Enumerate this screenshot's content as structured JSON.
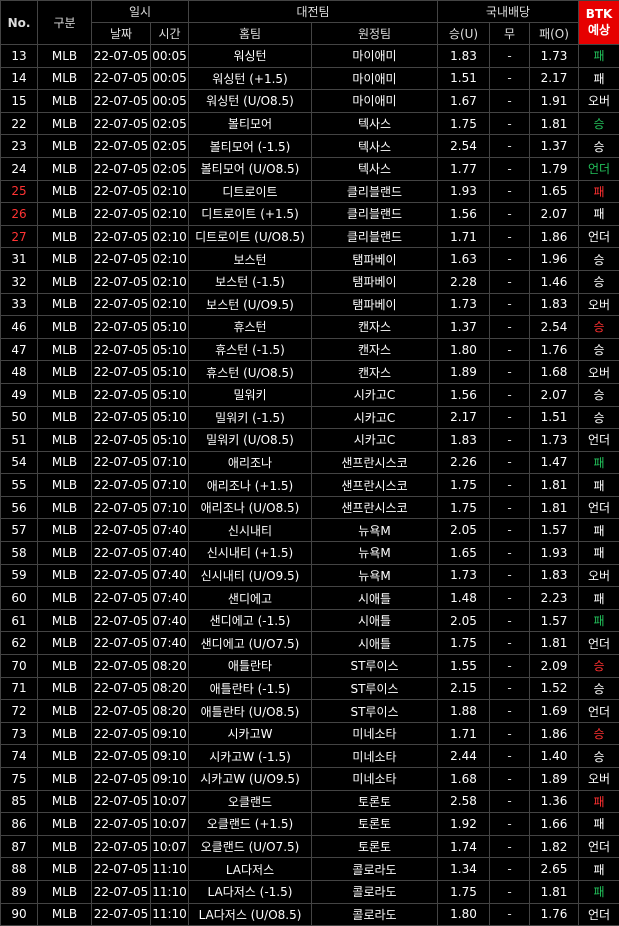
{
  "header": {
    "no": "No.",
    "category": "구분",
    "datetime": "일시",
    "date": "날짜",
    "time": "시간",
    "match": "대전팀",
    "home": "홈팀",
    "away": "원정팀",
    "odds": "국내배당",
    "win": "승(U)",
    "draw": "무",
    "lose": "패(O)",
    "btk_line1": "BTK",
    "btk_line2": "예상"
  },
  "colors": {
    "btk_header": "#e60000",
    "red": "#ff3030",
    "green": "#22c05a"
  },
  "rows": [
    {
      "no": "13",
      "no_color": "white",
      "cat": "MLB",
      "date": "22-07-05",
      "time": "00:05",
      "home": "워싱턴",
      "away": "마이애미",
      "win": "1.83",
      "draw": "-",
      "lose": "1.73",
      "pred": "패",
      "pred_color": "green"
    },
    {
      "no": "14",
      "no_color": "white",
      "cat": "MLB",
      "date": "22-07-05",
      "time": "00:05",
      "home": "워싱턴 (+1.5)",
      "away": "마이애미",
      "win": "1.51",
      "draw": "-",
      "lose": "2.17",
      "pred": "패",
      "pred_color": "white"
    },
    {
      "no": "15",
      "no_color": "white",
      "cat": "MLB",
      "date": "22-07-05",
      "time": "00:05",
      "home": "워싱턴 (U/O8.5)",
      "away": "마이애미",
      "win": "1.67",
      "draw": "-",
      "lose": "1.91",
      "pred": "오버",
      "pred_color": "white"
    },
    {
      "no": "22",
      "no_color": "white",
      "cat": "MLB",
      "date": "22-07-05",
      "time": "02:05",
      "home": "볼티모어",
      "away": "텍사스",
      "win": "1.75",
      "draw": "-",
      "lose": "1.81",
      "pred": "승",
      "pred_color": "green"
    },
    {
      "no": "23",
      "no_color": "white",
      "cat": "MLB",
      "date": "22-07-05",
      "time": "02:05",
      "home": "볼티모어 (-1.5)",
      "away": "텍사스",
      "win": "2.54",
      "draw": "-",
      "lose": "1.37",
      "pred": "승",
      "pred_color": "white"
    },
    {
      "no": "24",
      "no_color": "white",
      "cat": "MLB",
      "date": "22-07-05",
      "time": "02:05",
      "home": "볼티모어 (U/O8.5)",
      "away": "텍사스",
      "win": "1.77",
      "draw": "-",
      "lose": "1.79",
      "pred": "언더",
      "pred_color": "green"
    },
    {
      "no": "25",
      "no_color": "red",
      "cat": "MLB",
      "date": "22-07-05",
      "time": "02:10",
      "home": "디트로이트",
      "away": "클리블랜드",
      "win": "1.93",
      "draw": "-",
      "lose": "1.65",
      "pred": "패",
      "pred_color": "red"
    },
    {
      "no": "26",
      "no_color": "red",
      "cat": "MLB",
      "date": "22-07-05",
      "time": "02:10",
      "home": "디트로이트 (+1.5)",
      "away": "클리블랜드",
      "win": "1.56",
      "draw": "-",
      "lose": "2.07",
      "pred": "패",
      "pred_color": "white"
    },
    {
      "no": "27",
      "no_color": "red",
      "cat": "MLB",
      "date": "22-07-05",
      "time": "02:10",
      "home": "디트로이트 (U/O8.5)",
      "away": "클리블랜드",
      "win": "1.71",
      "draw": "-",
      "lose": "1.86",
      "pred": "언더",
      "pred_color": "white"
    },
    {
      "no": "31",
      "no_color": "white",
      "cat": "MLB",
      "date": "22-07-05",
      "time": "02:10",
      "home": "보스턴",
      "away": "탬파베이",
      "win": "1.63",
      "draw": "-",
      "lose": "1.96",
      "pred": "승",
      "pred_color": "white"
    },
    {
      "no": "32",
      "no_color": "white",
      "cat": "MLB",
      "date": "22-07-05",
      "time": "02:10",
      "home": "보스턴 (-1.5)",
      "away": "탬파베이",
      "win": "2.28",
      "draw": "-",
      "lose": "1.46",
      "pred": "승",
      "pred_color": "white"
    },
    {
      "no": "33",
      "no_color": "white",
      "cat": "MLB",
      "date": "22-07-05",
      "time": "02:10",
      "home": "보스턴 (U/O9.5)",
      "away": "탬파베이",
      "win": "1.73",
      "draw": "-",
      "lose": "1.83",
      "pred": "오버",
      "pred_color": "white"
    },
    {
      "no": "46",
      "no_color": "white",
      "cat": "MLB",
      "date": "22-07-05",
      "time": "05:10",
      "home": "휴스턴",
      "away": "캔자스",
      "win": "1.37",
      "draw": "-",
      "lose": "2.54",
      "pred": "승",
      "pred_color": "red"
    },
    {
      "no": "47",
      "no_color": "white",
      "cat": "MLB",
      "date": "22-07-05",
      "time": "05:10",
      "home": "휴스턴 (-1.5)",
      "away": "캔자스",
      "win": "1.80",
      "draw": "-",
      "lose": "1.76",
      "pred": "승",
      "pred_color": "white"
    },
    {
      "no": "48",
      "no_color": "white",
      "cat": "MLB",
      "date": "22-07-05",
      "time": "05:10",
      "home": "휴스턴 (U/O8.5)",
      "away": "캔자스",
      "win": "1.89",
      "draw": "-",
      "lose": "1.68",
      "pred": "오버",
      "pred_color": "white"
    },
    {
      "no": "49",
      "no_color": "white",
      "cat": "MLB",
      "date": "22-07-05",
      "time": "05:10",
      "home": "밀워키",
      "away": "시카고C",
      "win": "1.56",
      "draw": "-",
      "lose": "2.07",
      "pred": "승",
      "pred_color": "white"
    },
    {
      "no": "50",
      "no_color": "white",
      "cat": "MLB",
      "date": "22-07-05",
      "time": "05:10",
      "home": "밀워키 (-1.5)",
      "away": "시카고C",
      "win": "2.17",
      "draw": "-",
      "lose": "1.51",
      "pred": "승",
      "pred_color": "white"
    },
    {
      "no": "51",
      "no_color": "white",
      "cat": "MLB",
      "date": "22-07-05",
      "time": "05:10",
      "home": "밀워키 (U/O8.5)",
      "away": "시카고C",
      "win": "1.83",
      "draw": "-",
      "lose": "1.73",
      "pred": "언더",
      "pred_color": "white"
    },
    {
      "no": "54",
      "no_color": "white",
      "cat": "MLB",
      "date": "22-07-05",
      "time": "07:10",
      "home": "애리조나",
      "away": "샌프란시스코",
      "win": "2.26",
      "draw": "-",
      "lose": "1.47",
      "pred": "패",
      "pred_color": "green"
    },
    {
      "no": "55",
      "no_color": "white",
      "cat": "MLB",
      "date": "22-07-05",
      "time": "07:10",
      "home": "애리조나 (+1.5)",
      "away": "샌프란시스코",
      "win": "1.75",
      "draw": "-",
      "lose": "1.81",
      "pred": "패",
      "pred_color": "white"
    },
    {
      "no": "56",
      "no_color": "white",
      "cat": "MLB",
      "date": "22-07-05",
      "time": "07:10",
      "home": "애리조나 (U/O8.5)",
      "away": "샌프란시스코",
      "win": "1.75",
      "draw": "-",
      "lose": "1.81",
      "pred": "언더",
      "pred_color": "white"
    },
    {
      "no": "57",
      "no_color": "white",
      "cat": "MLB",
      "date": "22-07-05",
      "time": "07:40",
      "home": "신시내티",
      "away": "뉴욕M",
      "win": "2.05",
      "draw": "-",
      "lose": "1.57",
      "pred": "패",
      "pred_color": "white"
    },
    {
      "no": "58",
      "no_color": "white",
      "cat": "MLB",
      "date": "22-07-05",
      "time": "07:40",
      "home": "신시내티 (+1.5)",
      "away": "뉴욕M",
      "win": "1.65",
      "draw": "-",
      "lose": "1.93",
      "pred": "패",
      "pred_color": "white"
    },
    {
      "no": "59",
      "no_color": "white",
      "cat": "MLB",
      "date": "22-07-05",
      "time": "07:40",
      "home": "신시내티 (U/O9.5)",
      "away": "뉴욕M",
      "win": "1.73",
      "draw": "-",
      "lose": "1.83",
      "pred": "오버",
      "pred_color": "white"
    },
    {
      "no": "60",
      "no_color": "white",
      "cat": "MLB",
      "date": "22-07-05",
      "time": "07:40",
      "home": "샌디에고",
      "away": "시애틀",
      "win": "1.48",
      "draw": "-",
      "lose": "2.23",
      "pred": "패",
      "pred_color": "white"
    },
    {
      "no": "61",
      "no_color": "white",
      "cat": "MLB",
      "date": "22-07-05",
      "time": "07:40",
      "home": "샌디에고 (-1.5)",
      "away": "시애틀",
      "win": "2.05",
      "draw": "-",
      "lose": "1.57",
      "pred": "패",
      "pred_color": "green"
    },
    {
      "no": "62",
      "no_color": "white",
      "cat": "MLB",
      "date": "22-07-05",
      "time": "07:40",
      "home": "샌디에고 (U/O7.5)",
      "away": "시애틀",
      "win": "1.75",
      "draw": "-",
      "lose": "1.81",
      "pred": "언더",
      "pred_color": "white"
    },
    {
      "no": "70",
      "no_color": "white",
      "cat": "MLB",
      "date": "22-07-05",
      "time": "08:20",
      "home": "애틀란타",
      "away": "ST루이스",
      "win": "1.55",
      "draw": "-",
      "lose": "2.09",
      "pred": "승",
      "pred_color": "red"
    },
    {
      "no": "71",
      "no_color": "white",
      "cat": "MLB",
      "date": "22-07-05",
      "time": "08:20",
      "home": "애틀란타 (-1.5)",
      "away": "ST루이스",
      "win": "2.15",
      "draw": "-",
      "lose": "1.52",
      "pred": "승",
      "pred_color": "white"
    },
    {
      "no": "72",
      "no_color": "white",
      "cat": "MLB",
      "date": "22-07-05",
      "time": "08:20",
      "home": "애틀란타 (U/O8.5)",
      "away": "ST루이스",
      "win": "1.88",
      "draw": "-",
      "lose": "1.69",
      "pred": "언더",
      "pred_color": "white"
    },
    {
      "no": "73",
      "no_color": "white",
      "cat": "MLB",
      "date": "22-07-05",
      "time": "09:10",
      "home": "시카고W",
      "away": "미네소타",
      "win": "1.71",
      "draw": "-",
      "lose": "1.86",
      "pred": "승",
      "pred_color": "red"
    },
    {
      "no": "74",
      "no_color": "white",
      "cat": "MLB",
      "date": "22-07-05",
      "time": "09:10",
      "home": "시카고W (-1.5)",
      "away": "미네소타",
      "win": "2.44",
      "draw": "-",
      "lose": "1.40",
      "pred": "승",
      "pred_color": "white"
    },
    {
      "no": "75",
      "no_color": "white",
      "cat": "MLB",
      "date": "22-07-05",
      "time": "09:10",
      "home": "시카고W (U/O9.5)",
      "away": "미네소타",
      "win": "1.68",
      "draw": "-",
      "lose": "1.89",
      "pred": "오버",
      "pred_color": "white"
    },
    {
      "no": "85",
      "no_color": "white",
      "cat": "MLB",
      "date": "22-07-05",
      "time": "10:07",
      "home": "오클랜드",
      "away": "토론토",
      "win": "2.58",
      "draw": "-",
      "lose": "1.36",
      "pred": "패",
      "pred_color": "red"
    },
    {
      "no": "86",
      "no_color": "white",
      "cat": "MLB",
      "date": "22-07-05",
      "time": "10:07",
      "home": "오클랜드 (+1.5)",
      "away": "토론토",
      "win": "1.92",
      "draw": "-",
      "lose": "1.66",
      "pred": "패",
      "pred_color": "white"
    },
    {
      "no": "87",
      "no_color": "white",
      "cat": "MLB",
      "date": "22-07-05",
      "time": "10:07",
      "home": "오클랜드 (U/O7.5)",
      "away": "토론토",
      "win": "1.74",
      "draw": "-",
      "lose": "1.82",
      "pred": "언더",
      "pred_color": "white"
    },
    {
      "no": "88",
      "no_color": "white",
      "cat": "MLB",
      "date": "22-07-05",
      "time": "11:10",
      "home": "LA다저스",
      "away": "콜로라도",
      "win": "1.34",
      "draw": "-",
      "lose": "2.65",
      "pred": "패",
      "pred_color": "white"
    },
    {
      "no": "89",
      "no_color": "white",
      "cat": "MLB",
      "date": "22-07-05",
      "time": "11:10",
      "home": "LA다저스 (-1.5)",
      "away": "콜로라도",
      "win": "1.75",
      "draw": "-",
      "lose": "1.81",
      "pred": "패",
      "pred_color": "green"
    },
    {
      "no": "90",
      "no_color": "white",
      "cat": "MLB",
      "date": "22-07-05",
      "time": "11:10",
      "home": "LA다저스 (U/O8.5)",
      "away": "콜로라도",
      "win": "1.80",
      "draw": "-",
      "lose": "1.76",
      "pred": "언더",
      "pred_color": "white"
    }
  ]
}
